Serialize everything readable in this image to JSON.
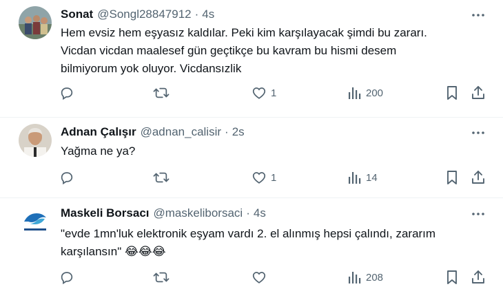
{
  "tweets": [
    {
      "name": "Sonat",
      "handle": "@Songl28847912",
      "separator": "·",
      "time": "4s",
      "lines": [
        "Hem evsiz hem eşyasız kaldılar. Peki kim karşılayacak şimdi bu zararı.",
        "Vicdan vicdan maalesef gün geçtikçe bu kavram bu hismi desem",
        "bilmiyorum yok oluyor. Vicdansızlik"
      ],
      "replies": "",
      "retweets": "",
      "likes": "1",
      "views": "200"
    },
    {
      "name": "Adnan Çalışır",
      "handle": "@adnan_calisir",
      "separator": "·",
      "time": "2s",
      "lines": [
        "Yağma ne ya?"
      ],
      "replies": "",
      "retweets": "",
      "likes": "1",
      "views": "14"
    },
    {
      "name": "Maskeli Borsacı",
      "handle": "@maskeliborsaci",
      "separator": "·",
      "time": "4s",
      "lines": [
        "\"evde 1mn'luk elektronik eşyam vardı 2. el alınmış hepsi çalındı, zararım",
        "karşılansın\" 😂😂😂"
      ],
      "replies": "",
      "retweets": "",
      "likes": "",
      "views": "208"
    }
  ],
  "colors": {
    "text": "#0f1419",
    "secondary": "#536471",
    "divider": "#eff3f4"
  },
  "icons": [
    "reply-icon",
    "retweet-icon",
    "like-icon",
    "views-icon",
    "bookmark-icon",
    "share-icon",
    "more-icon"
  ]
}
